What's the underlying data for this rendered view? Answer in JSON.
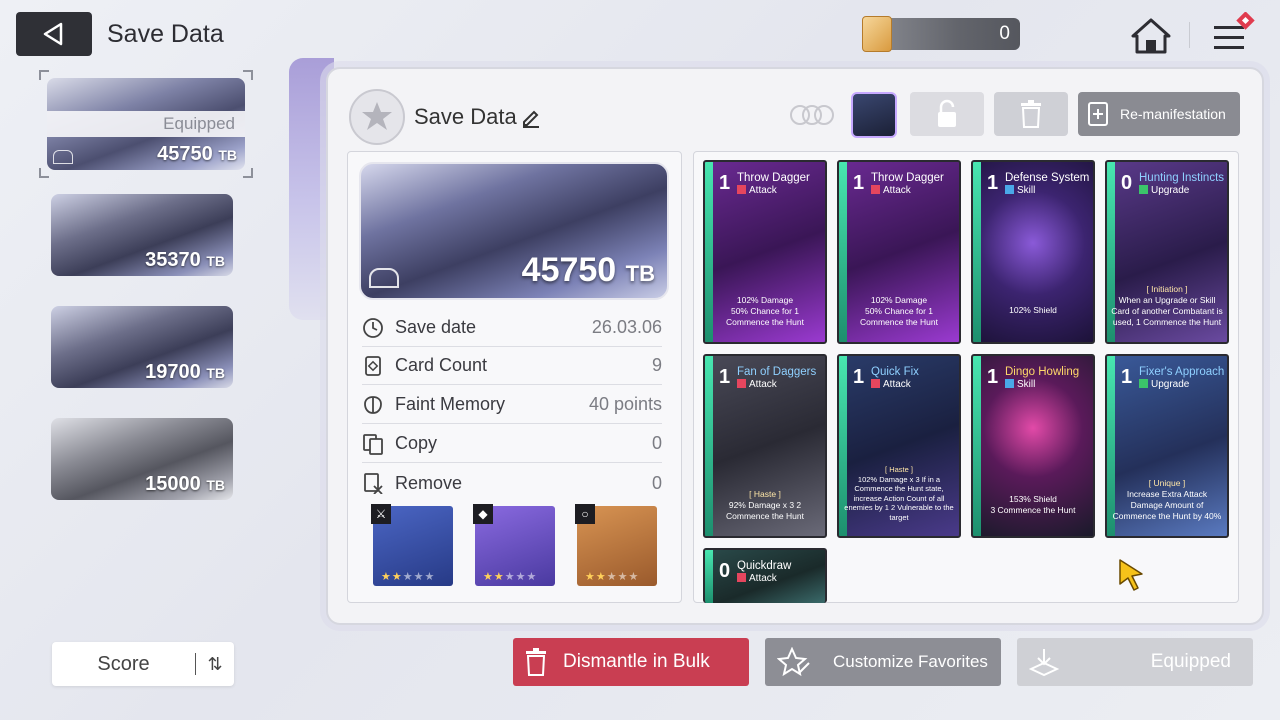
{
  "header": {
    "title": "Save Data",
    "currency_value": "0"
  },
  "slots": [
    {
      "value": "45750",
      "unit": "TB",
      "badge": "Equipped"
    },
    {
      "value": "35370",
      "unit": "TB"
    },
    {
      "value": "19700",
      "unit": "TB"
    },
    {
      "value": "15000",
      "unit": "TB"
    }
  ],
  "sort": {
    "label": "Score"
  },
  "panel": {
    "title": "Save Data",
    "remanifest_label": "Re-manifestation",
    "big_value": "45750",
    "big_unit": "TB",
    "rows": [
      {
        "label": "Save date",
        "value": "26.03.06"
      },
      {
        "label": "Card Count",
        "value": "9"
      },
      {
        "label": "Faint Memory",
        "value": "40 points"
      },
      {
        "label": "Copy",
        "value": "0"
      },
      {
        "label": "Remove",
        "value": "0"
      }
    ],
    "equipment": [
      {
        "name": "weapon",
        "stars": 2,
        "max": 5,
        "color": "#3a54b0"
      },
      {
        "name": "armor",
        "stars": 2,
        "max": 5,
        "color": "#6a4fc0"
      },
      {
        "name": "artifact",
        "stars": 2,
        "max": 5,
        "color": "#c47a3c"
      }
    ]
  },
  "cards": [
    {
      "cost": "1",
      "name": "Throw Dagger",
      "type": "Attack",
      "desc_pre": "102% Damage",
      "desc": "50% Chance for 1 Commence the Hunt",
      "bg": "purple"
    },
    {
      "cost": "1",
      "name": "Throw Dagger",
      "type": "Attack",
      "desc_pre": "102% Damage",
      "desc": "50% Chance for 1 Commence the Hunt",
      "bg": "purple"
    },
    {
      "cost": "1",
      "name": "Defense System",
      "type": "Skill",
      "desc_pre": "",
      "desc": "102% Shield",
      "bg": "violet"
    },
    {
      "cost": "0",
      "name": "Hunting Instincts",
      "type": "Upgrade",
      "desc_pre": "[ Initiation ]",
      "desc": "When an Upgrade or Skill Card of another Combatant is used, 1 Commence the Hunt",
      "bg": "violet"
    },
    {
      "cost": "1",
      "name": "Fan of Daggers",
      "type": "Attack",
      "desc_pre": "[ Haste ]",
      "desc": "92% Damage x 3 2 Commence the Hunt",
      "bg": "gray"
    },
    {
      "cost": "1",
      "name": "Quick Fix",
      "type": "Attack",
      "desc_pre": "[ Haste ]",
      "desc": "102% Damage x 3 If in a Commence the Hunt state, increase Action Count of all enemies by 1 2 Vulnerable to the target",
      "bg": "navy"
    },
    {
      "cost": "1",
      "name": "Dingo Howling",
      "type": "Skill",
      "desc_pre": "153% Shield",
      "desc": "3 Commence the Hunt",
      "bg": "pink"
    },
    {
      "cost": "1",
      "name": "Fixer's Approach",
      "type": "Upgrade",
      "desc_pre": "[ Unique ]",
      "desc": "Increase Extra Attack Damage Amount of Commence the Hunt by 40%",
      "bg": "blue"
    },
    {
      "cost": "0",
      "name": "Quickdraw",
      "type": "Attack",
      "desc_pre": "",
      "desc": "",
      "bg": "teal"
    }
  ],
  "bottom": {
    "bulk_label": "Dismantle in Bulk",
    "favorites_label": "Customize Favorites",
    "equipped_label": "Equipped"
  }
}
